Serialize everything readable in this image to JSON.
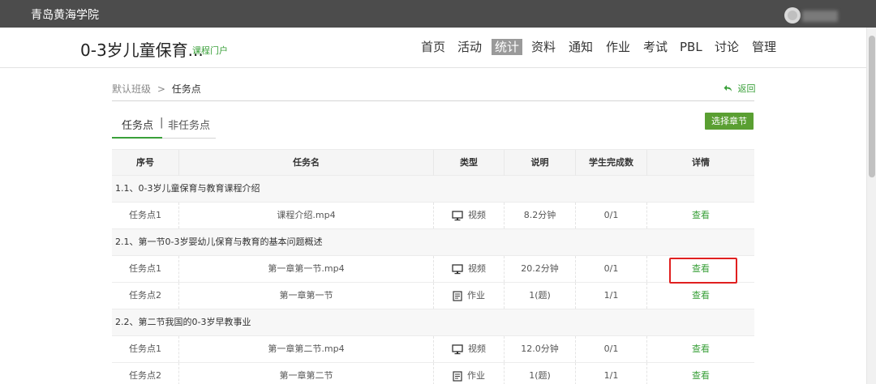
{
  "topbar": {
    "school_name": "青岛黄海学院"
  },
  "navbar": {
    "course_title": "0-3岁儿童保育...",
    "portal_link": "课程门户",
    "items": [
      {
        "label": "首页"
      },
      {
        "label": "活动"
      },
      {
        "label": "统计",
        "active": true
      },
      {
        "label": "资料"
      },
      {
        "label": "通知"
      },
      {
        "label": "作业"
      },
      {
        "label": "考试"
      },
      {
        "label": "PBL"
      },
      {
        "label": "讨论"
      },
      {
        "label": "管理"
      }
    ]
  },
  "breadcrumb": {
    "root": "默认班级",
    "separator": ">",
    "current": "任务点"
  },
  "back_link": {
    "label": "返回",
    "icon": "back-arrow-icon"
  },
  "tabs": {
    "active": "任务点",
    "separator": "|",
    "other": "非任务点"
  },
  "choose_chapter_button": "选择章节",
  "table": {
    "headers": [
      "序号",
      "任务名",
      "类型",
      "说明",
      "学生完成数",
      "详情"
    ],
    "sections": [
      {
        "title": "1.1、0-3岁儿童保育与教育课程介绍",
        "rows": [
          {
            "no": "任务点1",
            "name": "课程介绍.mp4",
            "type": "视频",
            "type_icon": "monitor-icon",
            "desc": "8.2分钟",
            "done": "0/1",
            "detail": "查看"
          }
        ]
      },
      {
        "title": "2.1、第一节0-3岁婴幼儿保育与教育的基本问题概述",
        "rows": [
          {
            "no": "任务点1",
            "name": "第一章第一节.mp4",
            "type": "视频",
            "type_icon": "monitor-icon",
            "desc": "20.2分钟",
            "done": "0/1",
            "detail": "查看",
            "highlighted": true
          },
          {
            "no": "任务点2",
            "name": "第一章第一节",
            "type": "作业",
            "type_icon": "document-icon",
            "desc": "1(题)",
            "done": "1/1",
            "detail": "查看"
          }
        ]
      },
      {
        "title": "2.2、第二节我国的0-3岁早教事业",
        "rows": [
          {
            "no": "任务点1",
            "name": "第一章第二节.mp4",
            "type": "视频",
            "type_icon": "monitor-icon",
            "desc": "12.0分钟",
            "done": "0/1",
            "detail": "查看"
          },
          {
            "no": "任务点2",
            "name": "第一章第二节",
            "type": "作业",
            "type_icon": "document-icon",
            "desc": "1(题)",
            "done": "1/1",
            "detail": "查看"
          }
        ]
      }
    ]
  },
  "colors": {
    "accent": "#3aa03a",
    "button": "#5a9f32",
    "topbar": "#4c4c4c",
    "highlight": "#e02020"
  }
}
